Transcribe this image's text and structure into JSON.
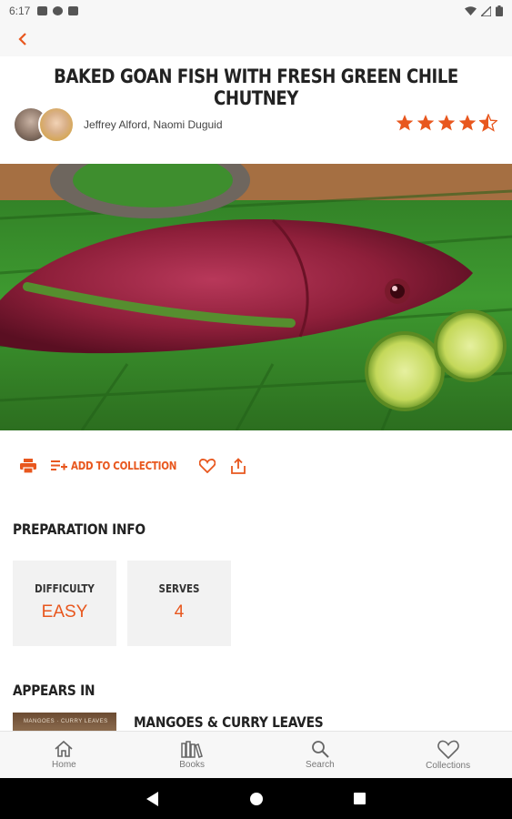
{
  "status_bar": {
    "time": "6:17"
  },
  "recipe": {
    "title": "BAKED GOAN FISH WITH FRESH GREEN CHILE CHUTNEY",
    "authors": "Jeffrey Alford, Naomi Duguid",
    "rating": 4.5
  },
  "actions": {
    "add_to_collection": "ADD TO COLLECTION"
  },
  "preparation": {
    "title": "PREPARATION INFO",
    "difficulty_label": "DIFFICULTY",
    "difficulty_value": "EASY",
    "serves_label": "SERVES",
    "serves_value": "4"
  },
  "appears_in": {
    "title": "APPEARS IN",
    "book_title": "MANGOES & CURRY LEAVES",
    "book_cover_text": "MANGOES · CURRY LEAVES"
  },
  "nav": {
    "home": "Home",
    "books": "Books",
    "search": "Search",
    "collections": "Collections"
  },
  "colors": {
    "accent": "#e8571e",
    "status_bg": "#f7f7f7",
    "card_bg": "#f2f2f2"
  },
  "icons": [
    "back-icon",
    "print-icon",
    "add-to-list-icon",
    "heart-icon",
    "share-icon",
    "home-icon",
    "books-icon",
    "search-icon",
    "collections-heart-icon",
    "android-back-icon",
    "android-home-icon",
    "android-recents-icon"
  ]
}
